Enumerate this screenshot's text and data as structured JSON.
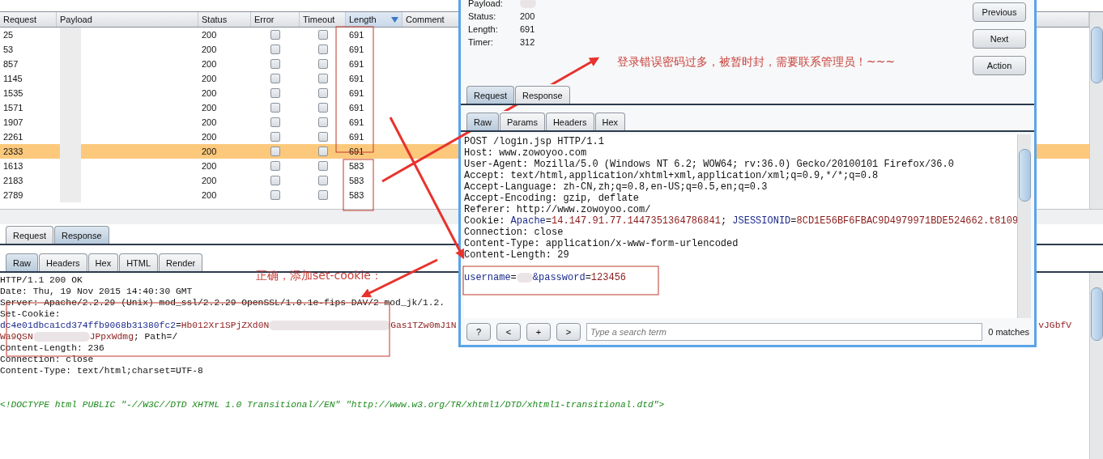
{
  "results_table": {
    "columns": [
      {
        "label": "Request",
        "sorted": false
      },
      {
        "label": "Payload",
        "sorted": false
      },
      {
        "label": "Status",
        "sorted": false
      },
      {
        "label": "Error",
        "sorted": false
      },
      {
        "label": "Timeout",
        "sorted": false
      },
      {
        "label": "Length",
        "sorted": true
      },
      {
        "label": "Comment",
        "sorted": false
      }
    ],
    "rows": [
      {
        "request": "25",
        "status": "200",
        "error": false,
        "timeout": false,
        "length": "691",
        "selected": false
      },
      {
        "request": "53",
        "status": "200",
        "error": false,
        "timeout": false,
        "length": "691",
        "selected": false
      },
      {
        "request": "857",
        "status": "200",
        "error": false,
        "timeout": false,
        "length": "691",
        "selected": false
      },
      {
        "request": "1145",
        "status": "200",
        "error": false,
        "timeout": false,
        "length": "691",
        "selected": false
      },
      {
        "request": "1535",
        "status": "200",
        "error": false,
        "timeout": false,
        "length": "691",
        "selected": false
      },
      {
        "request": "1571",
        "status": "200",
        "error": false,
        "timeout": false,
        "length": "691",
        "selected": false
      },
      {
        "request": "1907",
        "status": "200",
        "error": false,
        "timeout": false,
        "length": "691",
        "selected": false
      },
      {
        "request": "2261",
        "status": "200",
        "error": false,
        "timeout": false,
        "length": "691",
        "selected": false
      },
      {
        "request": "2333",
        "status": "200",
        "error": false,
        "timeout": false,
        "length": "691",
        "selected": true
      },
      {
        "request": "1613",
        "status": "200",
        "error": false,
        "timeout": false,
        "length": "583",
        "selected": false
      },
      {
        "request": "2183",
        "status": "200",
        "error": false,
        "timeout": false,
        "length": "583",
        "selected": false
      },
      {
        "request": "2789",
        "status": "200",
        "error": false,
        "timeout": false,
        "length": "583",
        "selected": false
      }
    ]
  },
  "response_panel": {
    "tabs": [
      {
        "label": "Request",
        "selected": false
      },
      {
        "label": "Response",
        "selected": true
      }
    ],
    "view_tabs": [
      {
        "label": "Raw",
        "selected": true
      },
      {
        "label": "Headers",
        "selected": false
      },
      {
        "label": "Hex",
        "selected": false
      },
      {
        "label": "HTML",
        "selected": false
      },
      {
        "label": "Render",
        "selected": false
      }
    ],
    "lines": [
      {
        "kind": "text",
        "segments": [
          {
            "kind": "plain",
            "text": "HTTP/1.1 200 OK"
          }
        ]
      },
      {
        "kind": "text",
        "segments": [
          {
            "kind": "plain",
            "text": "Date: Thu, 19 Nov 2015 14:40:30 GMT"
          }
        ]
      },
      {
        "kind": "text",
        "segments": [
          {
            "kind": "plain",
            "text": "Server: Apache/2.2.29 (Unix) mod_ssl/2.2.29 OpenSSL/1.0.1e-fips DAV/2 mod_jk/1.2."
          }
        ]
      },
      {
        "kind": "text",
        "segments": [
          {
            "kind": "plain",
            "text": "Set-Cookie:"
          }
        ]
      },
      {
        "kind": "text",
        "segments": [
          {
            "kind": "name",
            "text": "dc4e01dbca1cd374ffb9068b31380fc2"
          },
          {
            "kind": "plain",
            "text": "="
          },
          {
            "kind": "value",
            "text": "Hb012Xr1SPjZXd0N"
          },
          {
            "kind": "redacted"
          },
          {
            "kind": "value",
            "text": "Gas1TZw0mJ1N"
          },
          {
            "kind": "tail",
            "text": "vJGbfV"
          }
        ]
      },
      {
        "kind": "text",
        "segments": [
          {
            "kind": "value",
            "text": "Wa9QSN"
          },
          {
            "kind": "redacted"
          },
          {
            "kind": "value",
            "text": "JPpxWdmg"
          },
          {
            "kind": "plain",
            "text": "; Path=/"
          }
        ]
      },
      {
        "kind": "text",
        "segments": [
          {
            "kind": "plain",
            "text": "Content-Length: 236"
          }
        ]
      },
      {
        "kind": "text",
        "segments": [
          {
            "kind": "plain",
            "text": "Connection: close"
          }
        ]
      },
      {
        "kind": "text",
        "segments": [
          {
            "kind": "plain",
            "text": "Content-Type: text/html;charset=UTF-8"
          }
        ]
      },
      {
        "kind": "blank"
      },
      {
        "kind": "blank"
      },
      {
        "kind": "text",
        "segments": [
          {
            "kind": "markup",
            "text": "<!DOCTYPE html PUBLIC \"-//W3C//DTD XHTML 1.0 Transitional//EN\" \"http://www.w3.org/TR/xhtml1/DTD/xhtml1-transitional.dtd\">"
          }
        ]
      }
    ]
  },
  "dialog": {
    "fields": [
      {
        "label": "Payload:"
      },
      {
        "label": "Status:",
        "value": "200"
      },
      {
        "label": "Length:",
        "value": "691"
      },
      {
        "label": "Timer:",
        "value": "312"
      }
    ],
    "buttons": [
      "Previous",
      "Next",
      "Action"
    ],
    "tabs": [
      {
        "label": "Request",
        "selected": true
      },
      {
        "label": "Response",
        "selected": false
      }
    ],
    "view_tabs": [
      {
        "label": "Raw",
        "selected": true
      },
      {
        "label": "Params",
        "selected": false
      },
      {
        "label": "Headers",
        "selected": false
      },
      {
        "label": "Hex",
        "selected": false
      }
    ],
    "lines": [
      {
        "kind": "text",
        "segments": [
          {
            "kind": "plain",
            "text": "POST /login.jsp HTTP/1.1"
          }
        ]
      },
      {
        "kind": "text",
        "segments": [
          {
            "kind": "plain",
            "text": "Host: www.zowoyoo.com"
          }
        ]
      },
      {
        "kind": "text",
        "segments": [
          {
            "kind": "plain",
            "text": "User-Agent: Mozilla/5.0 (Windows NT 6.2; WOW64; rv:36.0) Gecko/20100101 Firefox/36.0"
          }
        ]
      },
      {
        "kind": "text",
        "segments": [
          {
            "kind": "plain",
            "text": "Accept: text/html,application/xhtml+xml,application/xml;q=0.9,*/*;q=0.8"
          }
        ]
      },
      {
        "kind": "text",
        "segments": [
          {
            "kind": "plain",
            "text": "Accept-Language: zh-CN,zh;q=0.8,en-US;q=0.5,en;q=0.3"
          }
        ]
      },
      {
        "kind": "text",
        "segments": [
          {
            "kind": "plain",
            "text": "Accept-Encoding: gzip, deflate"
          }
        ]
      },
      {
        "kind": "text",
        "segments": [
          {
            "kind": "plain",
            "text": "Referer: http://www.zowoyoo.com/"
          }
        ]
      },
      {
        "kind": "text",
        "segments": [
          {
            "kind": "plain",
            "text": "Cookie: "
          },
          {
            "kind": "name",
            "text": "Apache"
          },
          {
            "kind": "plain",
            "text": "="
          },
          {
            "kind": "value",
            "text": "14.147.91.77.1447351364786841"
          },
          {
            "kind": "plain",
            "text": "; "
          },
          {
            "kind": "name",
            "text": "JSESSIONID"
          },
          {
            "kind": "plain",
            "text": "="
          },
          {
            "kind": "value",
            "text": "8CD1E56BF6FBAC9D4979971BDE524662.t8109"
          }
        ]
      },
      {
        "kind": "text",
        "segments": [
          {
            "kind": "plain",
            "text": "Connection: close"
          }
        ]
      },
      {
        "kind": "text",
        "segments": [
          {
            "kind": "plain",
            "text": "Content-Type: application/x-www-form-urlencoded"
          }
        ]
      },
      {
        "kind": "text",
        "segments": [
          {
            "kind": "plain",
            "text": "Content-Length: 29"
          }
        ]
      },
      {
        "kind": "blank"
      },
      {
        "kind": "text",
        "segments": [
          {
            "kind": "name",
            "text": "username"
          },
          {
            "kind": "plain",
            "text": "="
          },
          {
            "kind": "redacted"
          },
          {
            "kind": "name",
            "text": "&password"
          },
          {
            "kind": "plain",
            "text": "="
          },
          {
            "kind": "value",
            "text": "123456"
          }
        ]
      }
    ],
    "search_buttons": [
      "?",
      "<",
      "+",
      ">"
    ],
    "search": {
      "placeholder": "Type a search term",
      "matches": "0 matches"
    }
  },
  "annotations": [
    {
      "kind": "blocked",
      "text": "登录错误密码过多，被暂时封，需要联系管理员！~~~"
    },
    {
      "kind": "success",
      "text": "正确，添加set-cookie："
    }
  ]
}
